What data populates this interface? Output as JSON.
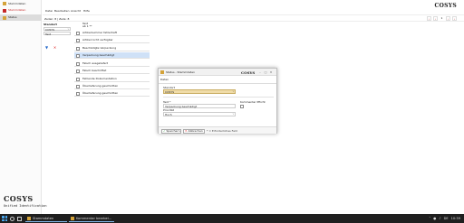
{
  "app": {
    "title": "Stammdaten"
  },
  "nav": {
    "items": [
      {
        "label": "Stammdaten"
      },
      {
        "label": "Status"
      }
    ]
  },
  "menu": {
    "items": [
      "Datei",
      "Bearbeiten",
      "Ansicht",
      "Hilfe"
    ]
  },
  "brand": {
    "name": "COSYS",
    "tagline": "Unified Identification"
  },
  "toolbar": {
    "summary": "Zeilen: 8 | Zeile: 8",
    "page": "1"
  },
  "filter": {
    "label": "Standort",
    "select_value": "COSYS",
    "input_value": "Text",
    "apply_icon": "filter-icon",
    "clear_icon": "clear-filter-icon"
  },
  "list": {
    "headers": [
      "Text",
      "ab 1 **"
    ],
    "rows": [
      {
        "label": "Artikelnummer fehlerhaft",
        "selected": false
      },
      {
        "label": "Artikel nicht verfügbar",
        "selected": false
      },
      {
        "label": "Beschädigte Verpackung",
        "selected": false
      },
      {
        "label": "Verpackung beschädigt",
        "selected": true
      },
      {
        "label": "Falsch ausgeliefert",
        "selected": false
      },
      {
        "label": "Falsch beschriftet",
        "selected": false
      },
      {
        "label": "Fehlende Dokumentation",
        "selected": false
      },
      {
        "label": "Überlieferung geschnitten",
        "selected": false
      },
      {
        "label": "Überlieferung geschnitten",
        "selected": false
      }
    ]
  },
  "dialog": {
    "title": "Status - Stammdaten",
    "tab": "Daten",
    "fields": {
      "standort_label": "Standort",
      "standort_value": "COSYS",
      "text_label": "Text *",
      "text_value": "Verpackung beschädigt",
      "prio_label": "Priorität",
      "prio_value": "Hoch",
      "kommentar_label": "Kommentar Pflicht"
    },
    "save": "Speichern",
    "cancel": "Abbrechen",
    "required_note": "* = Erforderliches Feld"
  },
  "taskbar": {
    "items": [
      "Stammdaten",
      "Kommentar bearbei..."
    ],
    "time": "10:39",
    "date": "DE"
  }
}
